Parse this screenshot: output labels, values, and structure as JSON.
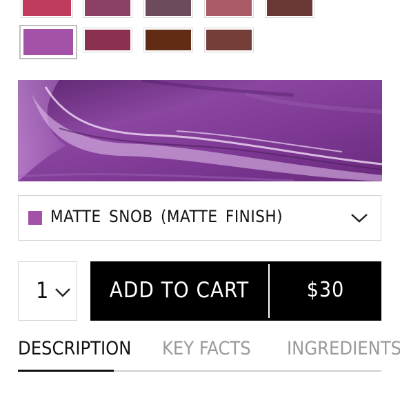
{
  "swatches": [
    {
      "color": "#c03c5c",
      "selected": false
    },
    {
      "color": "#8c4064",
      "selected": false
    },
    {
      "color": "#6c4c5c",
      "selected": false
    },
    {
      "color": "#a85a66",
      "selected": false
    },
    {
      "color": "#6a3834",
      "selected": false
    },
    {
      "color": "#a452a8",
      "selected": true
    },
    {
      "color": "#8a3050",
      "selected": false
    },
    {
      "color": "#622c14",
      "selected": false
    },
    {
      "color": "#763e38",
      "selected": false
    }
  ],
  "shade_texture": {
    "base_color": "#7c3c8c",
    "highlight_color": "#c080d0"
  },
  "shade_select": {
    "chip_color": "#a452a8",
    "label": "MATTE SNOB (MATTE FINISH)",
    "icon": "chevron-down-icon"
  },
  "quantity": {
    "value": "1",
    "icon": "chevron-down-icon"
  },
  "cart": {
    "label": "ADD TO CART",
    "price": "$30"
  },
  "tabs": [
    {
      "label": "DESCRIPTION",
      "active": true
    },
    {
      "label": "KEY FACTS",
      "active": false
    },
    {
      "label": "INGREDIENTS",
      "active": false
    }
  ]
}
